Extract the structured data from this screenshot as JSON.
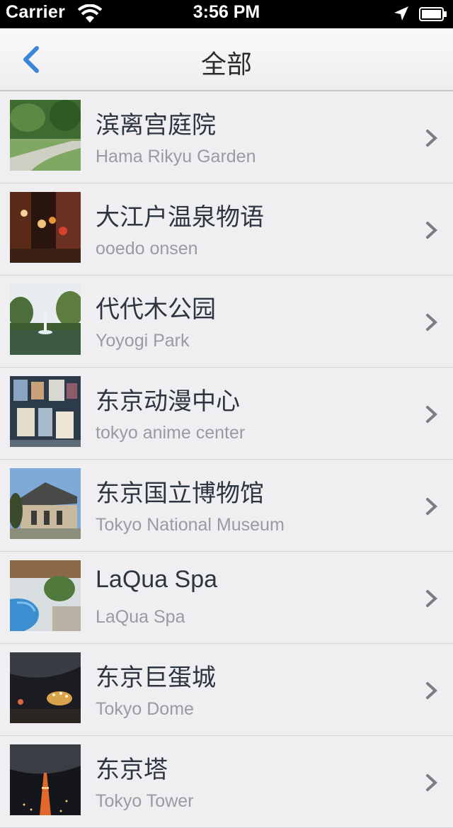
{
  "status_bar": {
    "carrier": "Carrier",
    "time": "3:56 PM"
  },
  "nav": {
    "title": "全部"
  },
  "items": [
    {
      "title": "滨离宫庭院",
      "subtitle": "Hama Rikyu Garden"
    },
    {
      "title": "大江户温泉物语",
      "subtitle": "ooedo onsen"
    },
    {
      "title": "代代木公园",
      "subtitle": "Yoyogi Park"
    },
    {
      "title": "东京动漫中心",
      "subtitle": "tokyo anime center"
    },
    {
      "title": "东京国立博物馆",
      "subtitle": "Tokyo National Museum"
    },
    {
      "title": "LaQua Spa",
      "subtitle": "LaQua Spa"
    },
    {
      "title": "东京巨蛋城",
      "subtitle": "Tokyo Dome"
    },
    {
      "title": "东京塔",
      "subtitle": "Tokyo Tower"
    }
  ],
  "colors": {
    "accent": "#3a86d8",
    "background": "#efeff2",
    "title_text": "#2d3540",
    "subtitle_text": "#9a9aa0"
  }
}
